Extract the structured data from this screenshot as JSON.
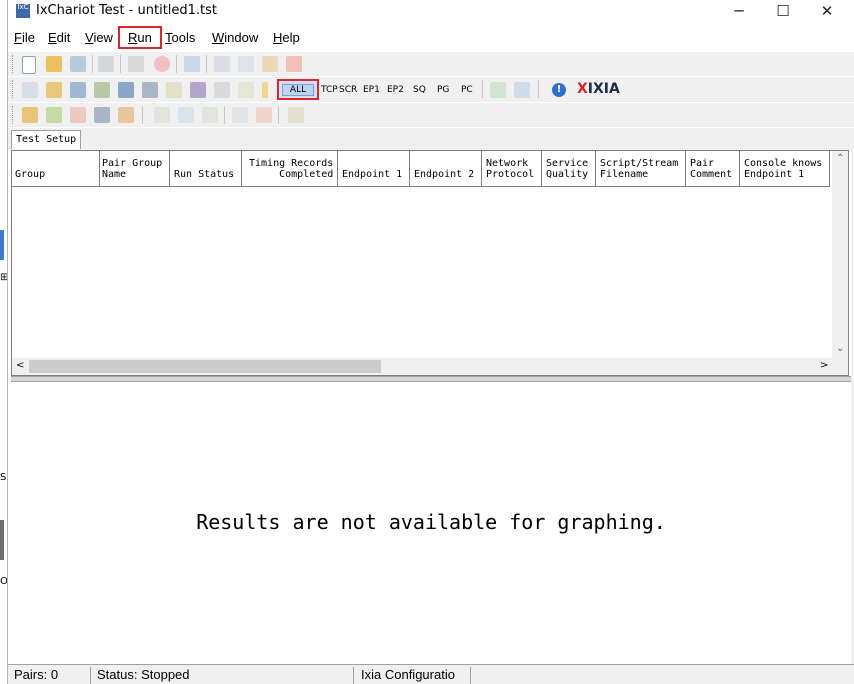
{
  "window": {
    "title": "IxChariot Test - untitled1.tst",
    "app_icon_text": "IxC"
  },
  "menus": [
    {
      "label": "File",
      "accel": "F",
      "rest": "ile"
    },
    {
      "label": "Edit",
      "accel": "E",
      "rest": "dit"
    },
    {
      "label": "View",
      "accel": "V",
      "rest": "iew"
    },
    {
      "label": "Run",
      "accel": "R",
      "rest": "un"
    },
    {
      "label": "Tools",
      "accel": "T",
      "rest": "ools"
    },
    {
      "label": "Window",
      "accel": "W",
      "rest": "indow"
    },
    {
      "label": "Help",
      "accel": "H",
      "rest": "elp"
    }
  ],
  "filter_toolbar": {
    "all_label": "ALL",
    "labels": [
      "TCP",
      "SCR",
      "EP1",
      "EP2",
      "SQ",
      "PG",
      "PC"
    ],
    "brand": "IXIA",
    "brand_x": "X"
  },
  "tab": {
    "label": "Test Setup"
  },
  "grid": {
    "columns": [
      {
        "line1": "",
        "line2": "Group"
      },
      {
        "line1": "Pair Group",
        "line2": "Name"
      },
      {
        "line1": "",
        "line2": "Run Status"
      },
      {
        "line1": "Timing Records",
        "line2": "     Completed"
      },
      {
        "line1": "",
        "line2": "Endpoint 1"
      },
      {
        "line1": "",
        "line2": "Endpoint 2"
      },
      {
        "line1": "Network",
        "line2": "Protocol"
      },
      {
        "line1": "Service",
        "line2": "Quality"
      },
      {
        "line1": "Script/Stream",
        "line2": "Filename"
      },
      {
        "line1": "Pair",
        "line2": "Comment"
      },
      {
        "line1": "Console knows",
        "line2": "Endpoint 1"
      }
    ]
  },
  "graph": {
    "message": "Results are not available for graphing."
  },
  "status": {
    "pairs": "Pairs: 0",
    "status": "Status: Stopped",
    "config": "Ixia Configuratio"
  },
  "colors": {
    "highlight": "#e0242b",
    "brand_x": "#d4262c"
  }
}
